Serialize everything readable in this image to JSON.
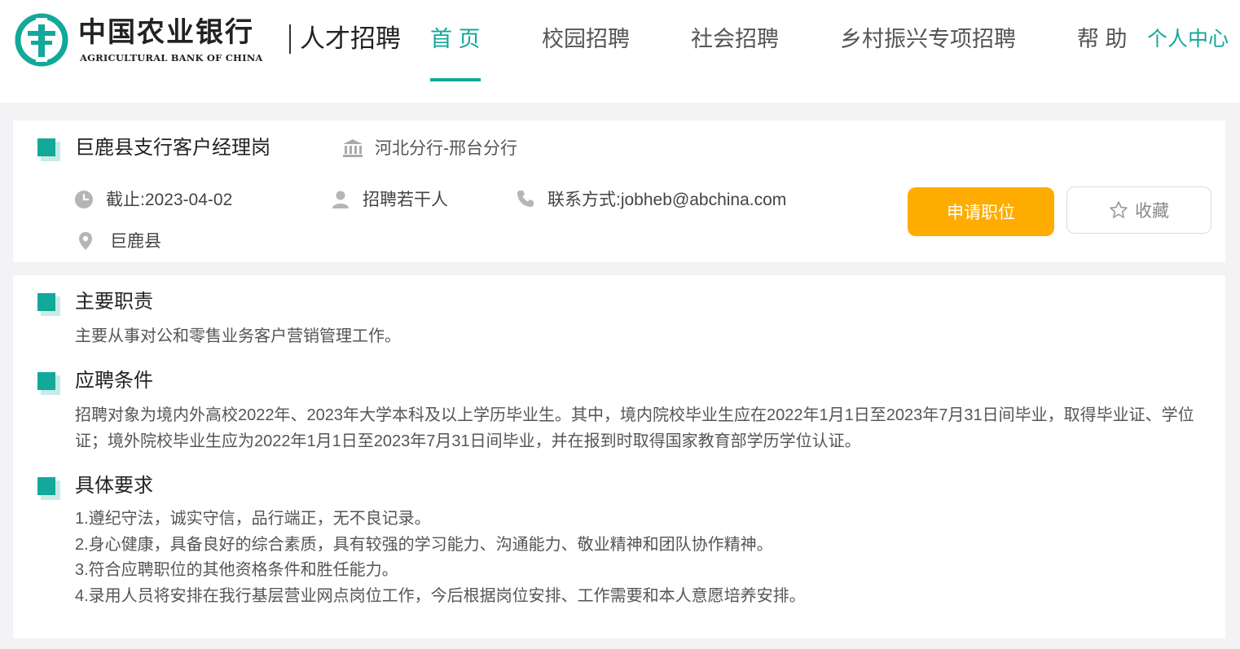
{
  "header": {
    "logo_cn": "中国农业银行",
    "logo_en": "AGRICULTURAL BANK OF CHINA",
    "logo_sub": "人才招聘",
    "nav": {
      "home": "首 页",
      "campus": "校园招聘",
      "social": "社会招聘",
      "rural": "乡村振兴专项招聘",
      "help": "帮 助"
    },
    "user_center": "个人中心"
  },
  "job": {
    "title": "巨鹿县支行客户经理岗",
    "branch": "河北分行-邢台分行",
    "deadline": "截止:2023-04-02",
    "headcount": "招聘若干人",
    "contact": "联系方式:jobheb@abchina.com",
    "location": "巨鹿县",
    "apply_label": "申请职位",
    "favorite_label": "收藏"
  },
  "sections": {
    "duties": {
      "title": "主要职责",
      "text": "主要从事对公和零售业务客户营销管理工作。"
    },
    "conditions": {
      "title": "应聘条件",
      "text": "招聘对象为境内外高校2022年、2023年大学本科及以上学历毕业生。其中，境内院校毕业生应在2022年1月1日至2023年7月31日间毕业，取得毕业证、学位证；境外院校毕业生应为2022年1月1日至2023年7月31日间毕业，并在报到时取得国家教育部学历学位认证。"
    },
    "requirements": {
      "title": "具体要求",
      "items": [
        "1.遵纪守法，诚实守信，品行端正，无不良记录。",
        "2.身心健康，具备良好的综合素质，具有较强的学习能力、沟通能力、敬业精神和团队协作精神。",
        "3.符合应聘职位的其他资格条件和胜任能力。",
        "4.录用人员将安排在我行基层营业网点岗位工作，今后根据岗位安排、工作需要和本人意愿培养安排。"
      ]
    }
  },
  "colors": {
    "brand": "#12a89a",
    "apply": "#ffac00"
  }
}
